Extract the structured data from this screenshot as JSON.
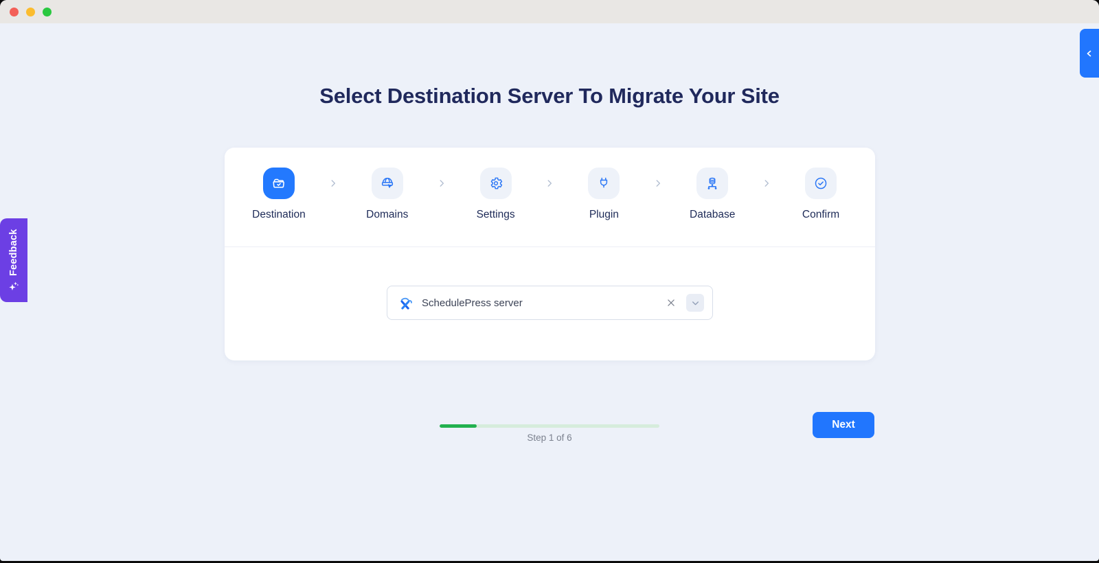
{
  "window": {
    "traffic_lights": [
      "close",
      "minimize",
      "zoom"
    ]
  },
  "page": {
    "heading": "Select Destination Server To Migrate Your Site"
  },
  "stepper": {
    "steps": [
      {
        "label": "Destination",
        "icon": "folder-check-icon",
        "state": "active"
      },
      {
        "label": "Domains",
        "icon": "globe-cursor-icon",
        "state": "upcoming"
      },
      {
        "label": "Settings",
        "icon": "gear-icon",
        "state": "upcoming"
      },
      {
        "label": "Plugin",
        "icon": "plug-icon",
        "state": "upcoming"
      },
      {
        "label": "Database",
        "icon": "database-icon",
        "state": "upcoming"
      },
      {
        "label": "Confirm",
        "icon": "check-circle-icon",
        "state": "upcoming"
      }
    ],
    "separator_icon": "chevron-right-icon"
  },
  "destination_select": {
    "value": "SchedulePress server",
    "icon": "xcloud-logo-icon",
    "clear_icon": "close-icon",
    "dropdown_icon": "chevron-down-icon"
  },
  "progress": {
    "step_label": "Step 1 of 6",
    "current_step": 1,
    "total_steps": 6,
    "percent": 17
  },
  "actions": {
    "next_label": "Next"
  },
  "feedback": {
    "label": "Feedback",
    "icon": "sparkles-icon"
  },
  "colors": {
    "accent_blue": "#2176fe",
    "active_step_blue": "#2379fe",
    "heading_navy": "#20295c",
    "progress_green": "#22b14f",
    "progress_track": "#d6ecdc",
    "feedback_purple": "#6c3fe4",
    "card_white": "#ffffff",
    "page_background": "#edf1f9",
    "titlebar_gray": "#e9e7e4"
  }
}
